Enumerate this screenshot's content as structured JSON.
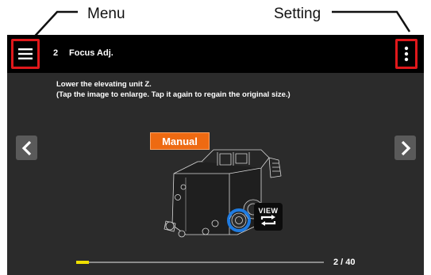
{
  "callouts": {
    "menu_label": "Menu",
    "setting_label": "Setting"
  },
  "appbar": {
    "step_number": "2",
    "step_title": "Focus Adj.",
    "menu_icon": "hamburger-icon",
    "settings_icon": "vertical-dots-icon"
  },
  "content": {
    "instruction_line1": "Lower the elevating unit Z.",
    "instruction_line2": "(Tap the image to enlarge. Tap it again to regain the original size.)",
    "mode_badge": "Manual",
    "view_button_label": "VIEW",
    "figure_alt": "microscope-illustration"
  },
  "navigation": {
    "prev_icon": "chevron-left-icon",
    "next_icon": "chevron-right-icon"
  },
  "progress": {
    "current": 2,
    "total": 40,
    "page_indicator": "2 / 40"
  },
  "colors": {
    "highlight_red": "#e0181b",
    "manual_orange": "#ee6a12",
    "progress_yellow": "#f0e000",
    "knob_blue": "#1f7be0"
  }
}
